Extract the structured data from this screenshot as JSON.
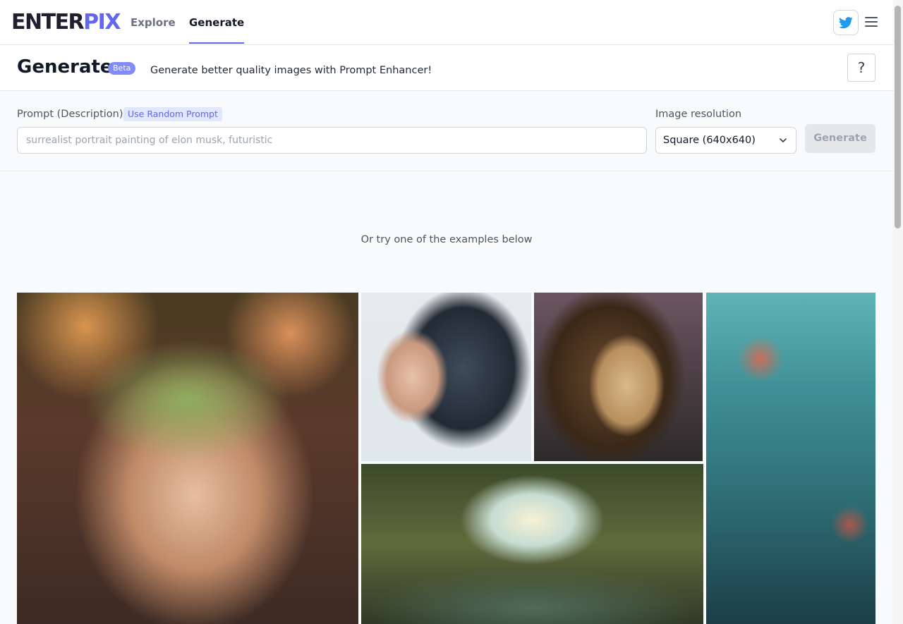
{
  "nav": {
    "logo_part1": "ENTER",
    "logo_part2": "PIX",
    "explore": "Explore",
    "generate": "Generate"
  },
  "header": {
    "title": "Generate",
    "badge": "Beta",
    "subtitle": "Generate better quality images with Prompt Enhancer!",
    "help": "?"
  },
  "form": {
    "prompt_label": "Prompt (Description)",
    "random_prompt": "Use Random Prompt",
    "prompt_placeholder": "surrealist portrait painting of elon musk, futuristic",
    "resolution_label": "Image resolution",
    "resolution_value": "Square (640x640)",
    "generate_button": "Generate"
  },
  "content": {
    "examples_text": "Or try one of the examples below"
  },
  "colors": {
    "accent": "#6366f1",
    "twitter": "#1d9bf0"
  }
}
